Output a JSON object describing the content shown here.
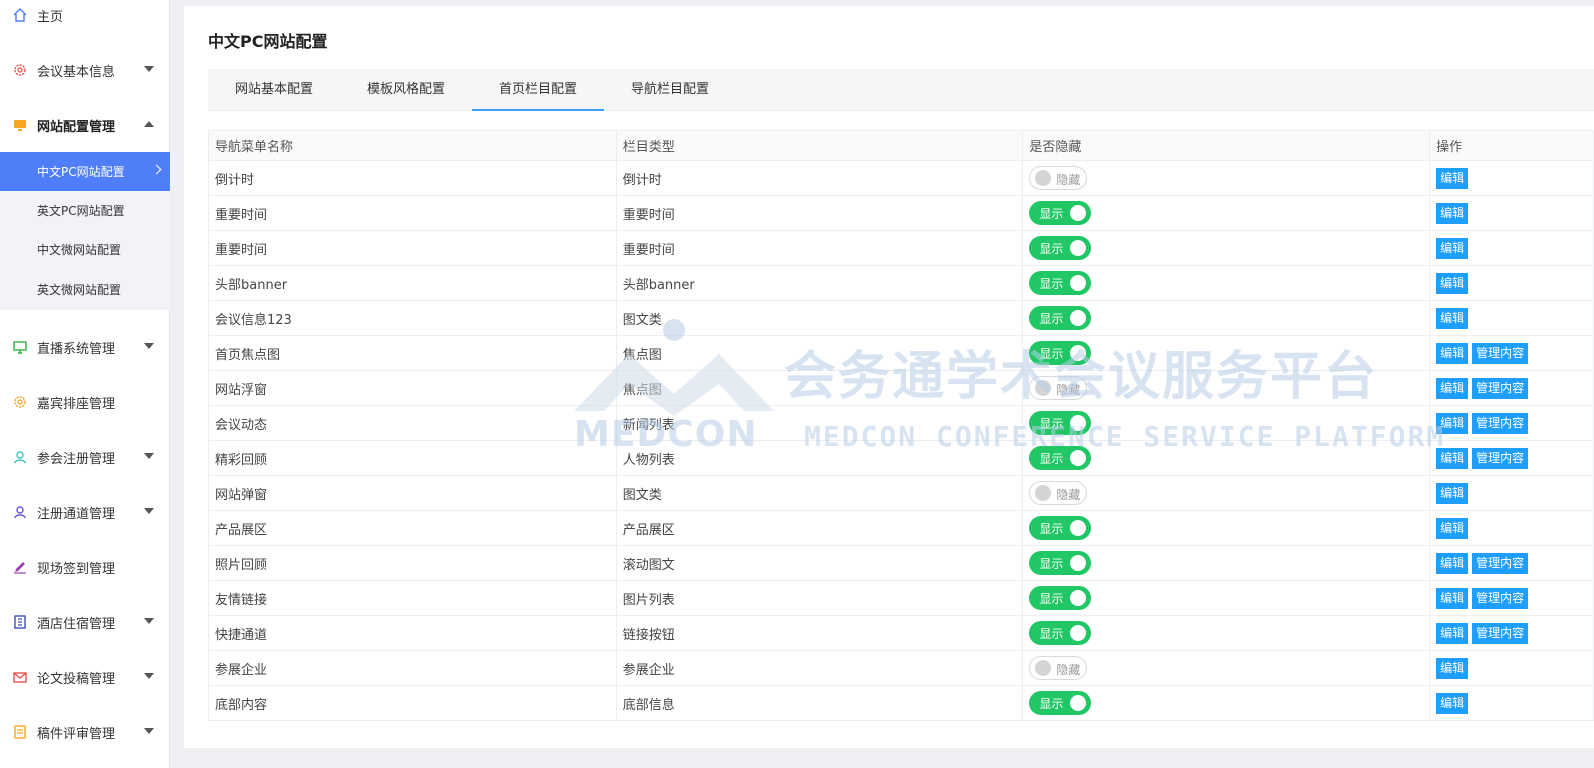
{
  "sidebar": {
    "home": "主页",
    "meeting_info": "会议基本信息",
    "site_config": "网站配置管理",
    "sub": [
      "中文PC网站配置",
      "英文PC网站配置",
      "中文微网站配置",
      "英文微网站配置"
    ],
    "live": "直播系统管理",
    "guest": "嘉宾排座管理",
    "registration": "参会注册管理",
    "reg_channel": "注册通道管理",
    "checkin": "现场签到管理",
    "hotel": "酒店住宿管理",
    "paper": "论文投稿管理",
    "review": "稿件评审管理"
  },
  "page": {
    "title": "中文PC网站配置",
    "tabs": [
      "网站基本配置",
      "模板风格配置",
      "首页栏目配置",
      "导航栏目配置"
    ]
  },
  "table": {
    "headers": [
      "导航菜单名称",
      "栏目类型",
      "是否隐藏",
      "操作"
    ],
    "show_label": "显示",
    "hide_label": "隐藏",
    "edit_label": "编辑",
    "manage_label": "管理内容",
    "rows": [
      {
        "name": "倒计时",
        "type": "倒计时",
        "shown": false,
        "manage": false
      },
      {
        "name": "重要时间",
        "type": "重要时间",
        "shown": true,
        "manage": false
      },
      {
        "name": "重要时间",
        "type": "重要时间",
        "shown": true,
        "manage": false
      },
      {
        "name": "头部banner",
        "type": "头部banner",
        "shown": true,
        "manage": false
      },
      {
        "name": "会议信息123",
        "type": "图文类",
        "shown": true,
        "manage": false
      },
      {
        "name": "首页焦点图",
        "type": "焦点图",
        "shown": true,
        "manage": true
      },
      {
        "name": "网站浮窗",
        "type": "焦点图",
        "shown": false,
        "manage": true
      },
      {
        "name": "会议动态",
        "type": "新闻列表",
        "shown": true,
        "manage": true
      },
      {
        "name": "精彩回顾",
        "type": "人物列表",
        "shown": true,
        "manage": true
      },
      {
        "name": "网站弹窗",
        "type": "图文类",
        "shown": false,
        "manage": false
      },
      {
        "name": "产品展区",
        "type": "产品展区",
        "shown": true,
        "manage": false
      },
      {
        "name": "照片回顾",
        "type": "滚动图文",
        "shown": true,
        "manage": true
      },
      {
        "name": "友情链接",
        "type": "图片列表",
        "shown": true,
        "manage": true
      },
      {
        "name": "快捷通道",
        "type": "链接按钮",
        "shown": true,
        "manage": true
      },
      {
        "name": "参展企业",
        "type": "参展企业",
        "shown": false,
        "manage": false
      },
      {
        "name": "底部内容",
        "type": "底部信息",
        "shown": true,
        "manage": false
      }
    ]
  },
  "watermark": {
    "cn": "会务通学术会议服务平台",
    "en": "MEDCON CONFERENCE SERVICE PLATFORM",
    "logo": "MEDCON"
  },
  "colors": {
    "accent": "#4f7ef8",
    "toggle_on": "#21c765",
    "button": "#1e9fff",
    "tab_underline": "#409eff"
  }
}
